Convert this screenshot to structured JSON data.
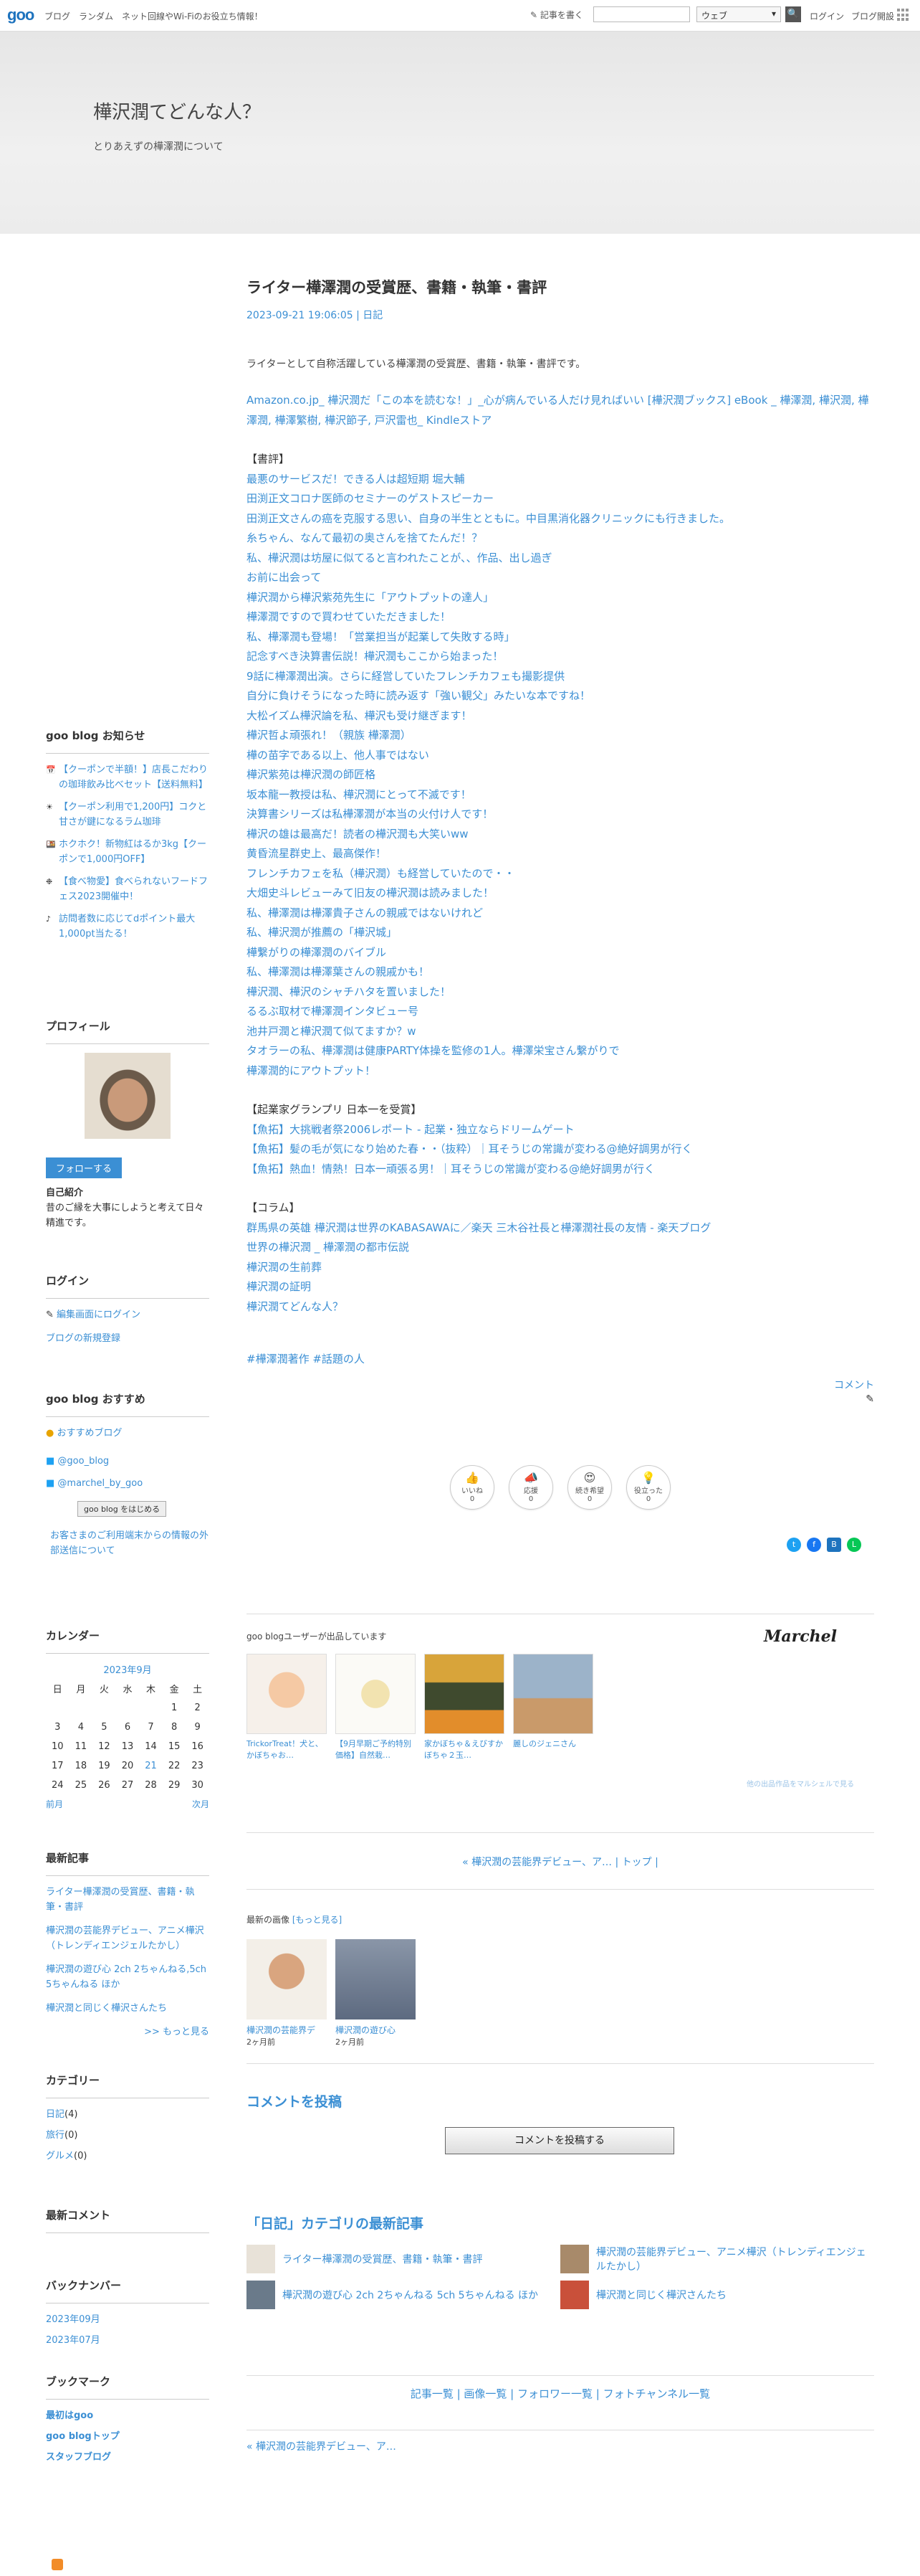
{
  "topbar": {
    "logo": "goo",
    "links": [
      "ブログ",
      "ランダム",
      "ネット回線やWi-Fiのお役立ち情報！"
    ],
    "write": "記事を書く",
    "search_select": "ウェブ",
    "search_btn": "🔍",
    "login": "ログイン",
    "help": "ブログ開設"
  },
  "header": {
    "title": "樺沢潤てどんな人？",
    "description": "とりあえずの樺澤潤について"
  },
  "entry": {
    "title": "ライター樺澤潤の受賞歴、書籍・執筆・書評",
    "meta": "2023-09-21 19:06:05 | 日記",
    "intro": "ライターとして自称活躍している樺澤潤の受賞歴、書籍・執筆・書評です。",
    "amazon": "Amazon.co.jp_ 樺沢潤だ「この本を読むな！」_心が病んでいる人だけ見ればいい [樺沢潤ブックス] eBook _ 樺澤潤, 樺沢潤, 樺澤潤, 樺澤繁樹, 樺沢節子, 戸沢雷也_ Kindleストア",
    "review_head": "【書評】",
    "reviews": [
      "最悪のサービスだ！できる人は超短期 堀大輔",
      "田渕正文コロナ医師のセミナーのゲストスピーカー",
      "田渕正文さんの癌を克服する思い、自身の半生とともに。中目黒消化器クリニックにも行きました。",
      "糸ちゃん、なんて最初の奥さんを捨てたんだ！？",
      "私、樺沢潤は坊屋に似てると言われたことが、、作品、出し過ぎ",
      "お前に出会って",
      "樺沢潤から樺沢紫苑先生に「アウトプットの達人」",
      "樺澤潤ですので買わせていただきました！",
      "私、樺澤潤も登場！「営業担当が起業して失敗する時」",
      "記念すべき決算書伝説！樺沢潤もここから始まった！",
      "9話に樺澤潤出演。さらに経営していたフレンチカフェも撮影提供",
      "自分に負けそうになった時に読み返す「強い観父」みたいな本ですね！",
      "大松イズム樺沢論を私、樺沢も受け継ぎます！",
      "樺沢哲よ頑張れ！（親族 樺澤潤）",
      "樺の苗字である以上、他人事ではない",
      "樺沢紫苑は樺沢潤の師匠格",
      "坂本龍一教授は私、樺沢潤にとって不滅です！",
      "決算書シリーズは私樺澤潤が本当の火付け人です！",
      "樺沢の雄は最高だ！読者の樺沢潤も大笑いww",
      "黄昏流星群史上、最高傑作！",
      "フレンチカフェを私（樺沢潤）も経営していたので・・",
      "大畑史斗レビューみて旧友の樺沢潤は読みました！",
      "私、樺澤潤は樺澤貴子さんの親戚ではないけれど",
      "私、樺沢潤が推薦の「樺沢城」",
      "樺繋がりの樺澤潤のバイブル",
      "私、樺澤潤は樺澤葉さんの親戚かも！",
      "樺沢潤、樺沢のシャチハタを置いました！",
      "るるぶ取材で樺澤潤インタビュー号",
      "池井戸潤と樺沢潤て似てますか？w",
      "タオラーの私、樺澤潤は健康PARTY体操を監修の1人。樺澤栄宝さん繋がりで",
      "樺澤潤的にアウトプット！"
    ],
    "award_head": "【起業家グランプリ 日本一を受賞】",
    "awards": [
      "【魚拓】大挑戦者祭2006レポート - 起業・独立ならドリームゲート",
      "【魚拓】髪の毛が気になり始めた春・・（抜粋）｜耳そうじの常識が変わる@絶好調男が行く",
      "【魚拓】熱血！情熱！日本一頑張る男！｜耳そうじの常識が変わる@絶好調男が行く"
    ],
    "column_head": "【コラム】",
    "columns": [
      "群馬県の英雄 樺沢潤は世界のKABASAWAに／楽天 三木谷社長と樺澤潤社長の友情 - 楽天ブログ",
      "世界の樺沢潤 _ 樺澤潤の都市伝説",
      "樺沢潤の生前葬",
      "樺沢潤の証明",
      "樺沢潤てどんな人？"
    ],
    "tags": "#樺澤潤著作 #話題の人",
    "comment": "コメント",
    "edit": "✎"
  },
  "reactions": [
    {
      "label": "いいね",
      "count": "0",
      "icon": "👍"
    },
    {
      "label": "応援",
      "count": "0",
      "icon": "📣"
    },
    {
      "label": "続き希望",
      "count": "0",
      "icon": "😍"
    },
    {
      "label": "役立った",
      "count": "0",
      "icon": "💡"
    }
  ],
  "marche": {
    "head": "goo blogユーザーが出品しています",
    "logo": "Marchel",
    "items": [
      "TrickorTreat！犬と、かぼちゃお…",
      "【9月早期ご予約特別価格】自然栽…",
      "家かぼちゃ＆えびすかぼちゃ２玉…",
      "麗しのジェニさん"
    ],
    "foot": "他の出品作品をマルシェルで見る"
  },
  "pager": "« 樺沢潤の芸能界デビュー、ア… | トップ |",
  "recent_images": {
    "head": "最新の画像",
    "more": "[もっと見る]",
    "items": [
      {
        "caption": "樺沢潤の芸能界デ",
        "date": "2ヶ月前"
      },
      {
        "caption": "樺沢潤の遊び心",
        "date": "2ヶ月前"
      }
    ]
  },
  "post_comment": {
    "heading": "コメントを投稿",
    "button": "コメントを投稿する"
  },
  "category_recent": {
    "heading": "「日記」カテゴリの最新記事",
    "items": [
      "ライター樺澤潤の受賞歴、書籍・執筆・書評",
      "樺沢潤の芸能界デビュー、アニメ樺沢（トレンディエンジェルたかし）",
      "樺沢潤の遊び心 2ch 2ちゃんねる 5ch 5ちゃんねる ほか",
      "樺沢潤と同じく樺沢さんたち"
    ]
  },
  "footer_links": "記事一覧 | 画像一覧 | フォロワー一覧 | フォトチャンネル一覧",
  "prev_bottom": "« 樺沢潤の芸能界デビュー、ア…",
  "sidebar": {
    "news": {
      "heading": "goo blog お知らせ",
      "items": [
        "【クーポンで半額！】店長こだわりの珈琲飲み比べセット【送料無料】",
        "【クーポン利用で1,200円】コクと甘さが鍵になるラム珈琲",
        "ホクホク！新物紅はるか3kg【クーポンで1,000円OFF】",
        "【食べ物愛】食べられないフードフェス2023開催中！",
        "訪問者数に応じてdポイント最大1,000pt当たる！"
      ]
    },
    "profile": {
      "heading": "プロフィール",
      "follow": "フォローする",
      "intro_head": "自己紹介",
      "intro": "昔のご縁を大事にしようと考えて日々精進です。"
    },
    "login": {
      "heading": "ログイン",
      "items": [
        "編集画面にログイン",
        "ブログの新規登録"
      ]
    },
    "recommend": {
      "heading": "goo blog おすすめ",
      "items": [
        "おすすめブログ",
        "@goo_blog",
        "@marchel_by_goo"
      ],
      "start": "goo blog をはじめる",
      "mobile": "お客さまのご利用端末からの情報の外部送信について"
    },
    "calendar": {
      "heading": "カレンダー",
      "month": "2023年9月",
      "weekdays": [
        "日",
        "月",
        "火",
        "水",
        "木",
        "金",
        "土"
      ],
      "rows": [
        [
          "",
          "",
          "",
          "",
          "",
          "1",
          "2"
        ],
        [
          "3",
          "4",
          "5",
          "6",
          "7",
          "8",
          "9"
        ],
        [
          "10",
          "11",
          "12",
          "13",
          "14",
          "15",
          "16"
        ],
        [
          "17",
          "18",
          "19",
          "20",
          "21",
          "22",
          "23"
        ],
        [
          "24",
          "25",
          "26",
          "27",
          "28",
          "29",
          "30"
        ]
      ],
      "prev": "前月",
      "next": "次月",
      "highlight": "21"
    },
    "latest": {
      "heading": "最新記事",
      "items": [
        "ライター樺澤潤の受賞歴、書籍・執筆・書評",
        "樺沢潤の芸能界デビュー、アニメ樺沢（トレンディエンジェルたかし）",
        "樺沢潤の遊び心 2ch 2ちゃんねる,5ch 5ちゃんねる ほか",
        "樺沢潤と同じく樺沢さんたち"
      ],
      "more": ">> もっと見る"
    },
    "category": {
      "heading": "カテゴリー",
      "items": [
        {
          "name": "日記",
          "count": "(4)"
        },
        {
          "name": "旅行",
          "count": "(0)"
        },
        {
          "name": "グルメ",
          "count": "(0)"
        }
      ]
    },
    "comments": {
      "heading": "最新コメント"
    },
    "backnumber": {
      "heading": "バックナンバー",
      "items": [
        "2023年09月",
        "2023年07月"
      ]
    },
    "bookmark": {
      "heading": "ブックマーク",
      "items": [
        "最初はgoo",
        "goo blogトップ",
        "スタッフブログ"
      ]
    }
  }
}
